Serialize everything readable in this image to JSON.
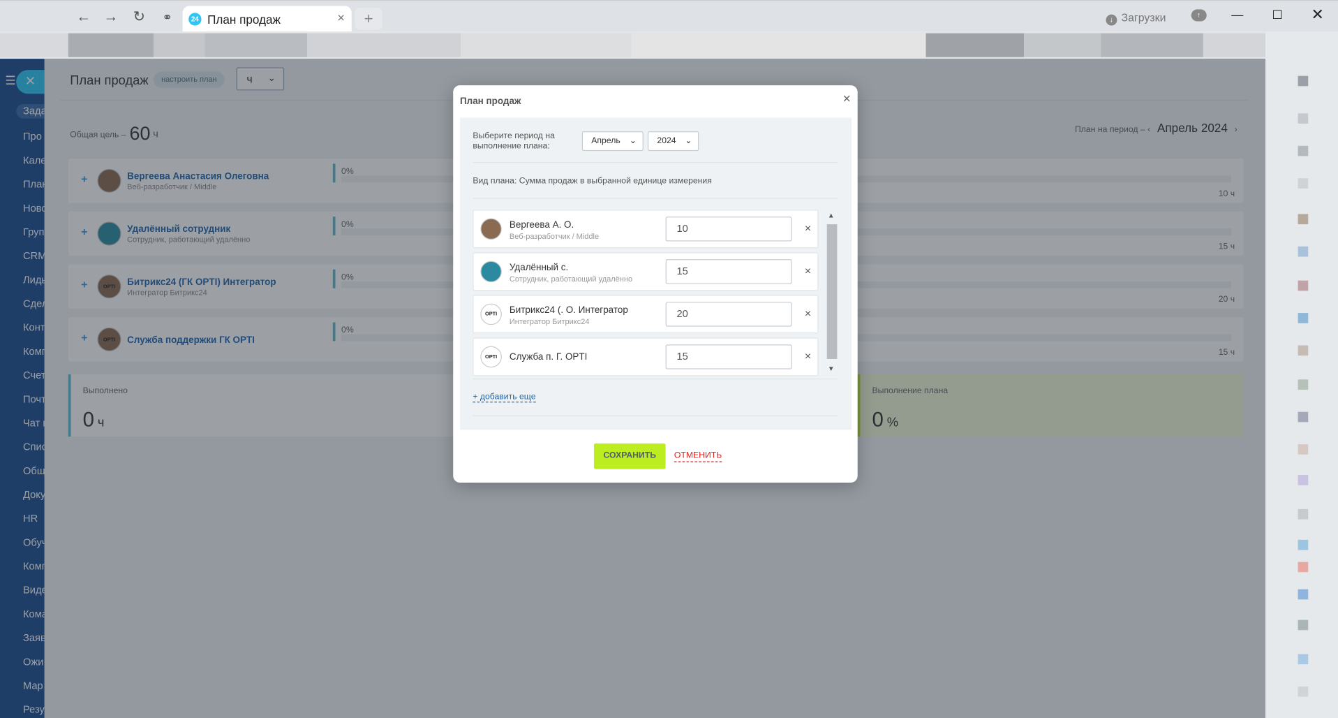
{
  "browser": {
    "tab_title": "План продаж",
    "tab_badge": "24",
    "downloads_label": "Загрузки"
  },
  "portal": {
    "rail_items": [
      "Зада",
      "Про",
      "Кале",
      "План",
      "Ново",
      "Груп",
      "CRM",
      "Лиды",
      "Сдел",
      "Конт",
      "Комп",
      "Счет",
      "Почт",
      "Чат и",
      "Спис",
      "Общ",
      "Доку",
      "HR",
      "Обуч",
      "Комп",
      "Виде",
      "Кома",
      "Заяв",
      "Ожи",
      "Мар",
      "Резу"
    ],
    "page_title": "План продаж",
    "configure_badge": "настроить план",
    "unit_select": "ч",
    "goal_label": "Общая цель –",
    "goal_value": "60",
    "goal_unit": "ч",
    "period_label": "План на период –",
    "period_value": "Апрель 2024",
    "employees": [
      {
        "name": "Вергеева Анастасия Олеговна",
        "role": "Веб-разработчик / Middle",
        "percent": "0%",
        "target": "10 ч"
      },
      {
        "name": "Удалённый сотрудник",
        "role": "Сотрудник, работающий удалённо",
        "percent": "0%",
        "target": "15 ч"
      },
      {
        "name": "Битрикс24 (ГК OPTI) Интегратор",
        "role": "Интегратор Битрикс24",
        "percent": "0%",
        "target": "20 ч"
      },
      {
        "name": "Служба поддержки ГК OPTI",
        "role": "",
        "percent": "0%",
        "target": "15 ч"
      }
    ],
    "done_label": "Выполнено",
    "done_value": "0",
    "done_unit": "ч",
    "plan_exec_label": "Выполнение плана",
    "plan_exec_value": "0",
    "plan_exec_unit": "%"
  },
  "dialog": {
    "title": "План продаж",
    "period_prompt": "Выберите период на выполнение плана:",
    "month": "Апрель",
    "year": "2024",
    "plan_type": "Вид плана: Сумма продаж в выбранной единице измерения",
    "items": [
      {
        "name": "Вергеева А. О.",
        "role": "Веб-разработчик / Middle",
        "value": "10"
      },
      {
        "name": "Удалённый с.",
        "role": "Сотрудник, работающий удалённо",
        "value": "15"
      },
      {
        "name": "Битрикс24 (. О. Интегратор",
        "role": "Интегратор Битрикс24",
        "value": "20"
      },
      {
        "name": "Служба п. Г. OPTI",
        "role": "",
        "value": "15"
      }
    ],
    "add_more": "+ добавить еще",
    "save": "СОХРАНИТЬ",
    "cancel": "ОТМЕНИТЬ"
  },
  "icons": {
    "back": "arrow-left-icon",
    "forward": "arrow-right-icon",
    "reload": "reload-icon",
    "link": "link-icon",
    "close": "close-icon",
    "plus": "plus-icon",
    "download": "download-icon",
    "cloud": "cloud-icon",
    "chevron": "chevron-down-icon",
    "avatar_logo": "OPTI"
  },
  "colors": {
    "accent": "#2fc6f6",
    "save_button": "#bbed21",
    "cancel_link": "#e02020",
    "link_blue": "#2067b0",
    "rail": "#1d4e8f"
  }
}
